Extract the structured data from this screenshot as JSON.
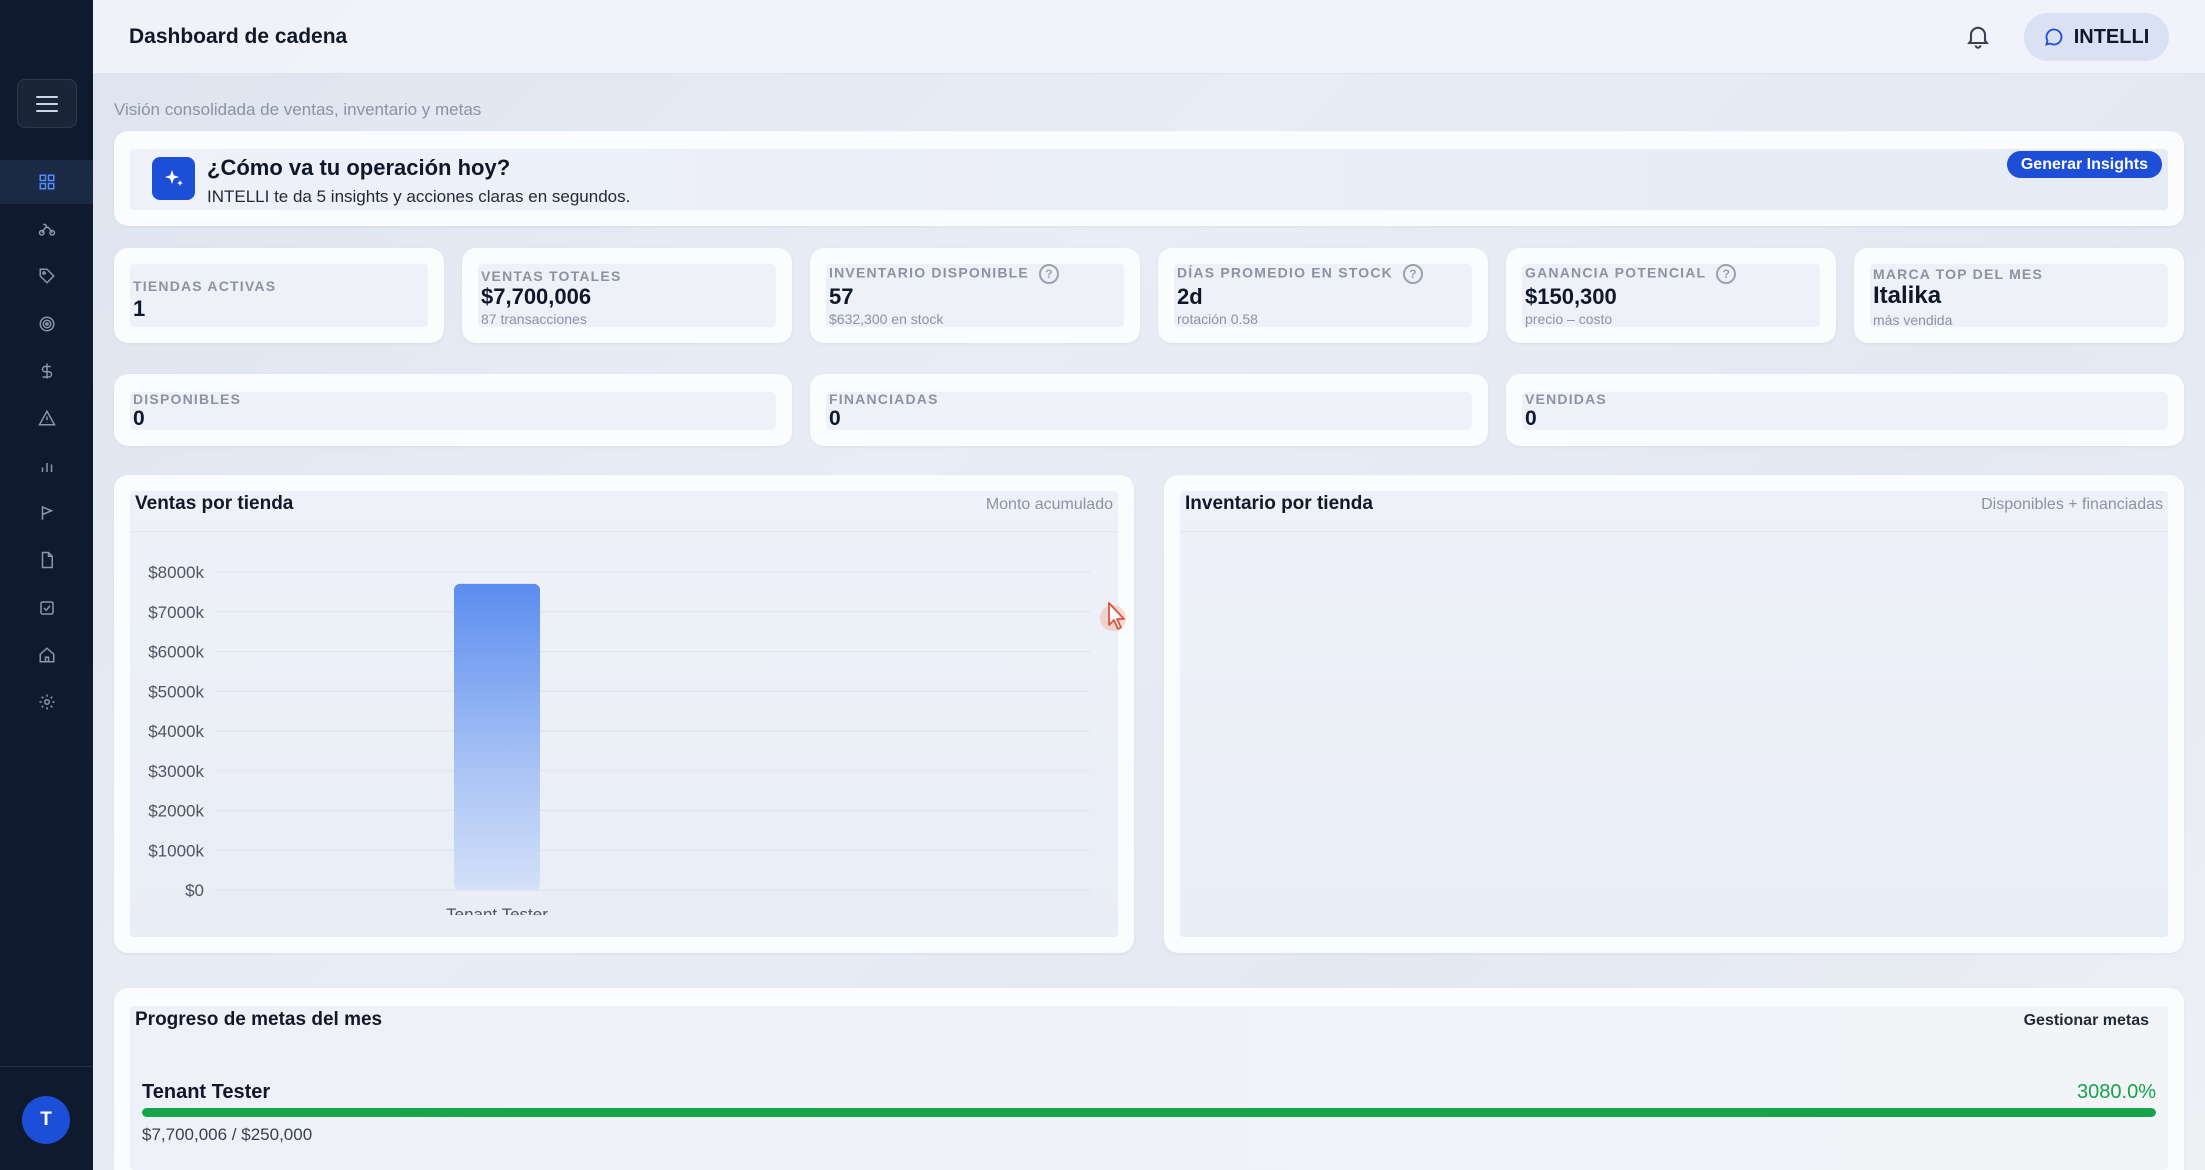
{
  "header": {
    "title": "Dashboard de cadena",
    "assistant_label": "INTELLI"
  },
  "subtitle": "Visión consolidada de ventas, inventario y metas",
  "insight": {
    "title": "¿Cómo va tu operación hoy?",
    "description": "INTELLI te da 5 insights y acciones claras en segundos.",
    "button_label": "Generar Insights"
  },
  "kpis": [
    {
      "label": "TIENDAS ACTIVAS",
      "value": "1",
      "sub": ""
    },
    {
      "label": "VENTAS TOTALES",
      "value": "$7,700,006",
      "sub": "87 transacciones"
    },
    {
      "label": "INVENTARIO DISPONIBLE",
      "value": "57",
      "sub": "$632,300 en stock",
      "help": "?"
    },
    {
      "label": "DÍAS PROMEDIO EN STOCK",
      "value": "2d",
      "sub": "rotación 0.58",
      "help": "?"
    },
    {
      "label": "GANANCIA POTENCIAL",
      "value": "$150,300",
      "sub": "precio – costo",
      "help": "?"
    },
    {
      "label": "MARCA TOP DEL MES",
      "value": "Italika",
      "sub": "más vendida"
    }
  ],
  "status": [
    {
      "label": "DISPONIBLES",
      "value": "0"
    },
    {
      "label": "FINANCIADAS",
      "value": "0"
    },
    {
      "label": "VENDIDAS",
      "value": "0"
    }
  ],
  "sales_chart": {
    "title": "Ventas por tienda",
    "note": "Monto acumulado"
  },
  "inventory_chart": {
    "title": "Inventario por tienda",
    "note": "Disponibles + financiadas"
  },
  "chart_data": {
    "type": "bar",
    "categories": [
      "Tenant Tester"
    ],
    "values": [
      7700006
    ],
    "ylim": [
      0,
      8000000
    ],
    "yticks": [
      "$0",
      "$1000k",
      "$2000k",
      "$3000k",
      "$4000k",
      "$5000k",
      "$6000k",
      "$7000k",
      "$8000k"
    ],
    "grid": true,
    "bar_color": "#5b8def"
  },
  "goals": {
    "title": "Progreso de metas del mes",
    "manage_label": "Gestionar metas",
    "items": [
      {
        "name": "Tenant Tester",
        "percent": "3080.0%",
        "amount": "$7,700,006 / $250,000",
        "progress": 1.0
      }
    ]
  },
  "user": {
    "initial": "T"
  },
  "colors": {
    "sidebar": "#0f1a2e",
    "accent": "#1d4ed8",
    "success": "#16a34a"
  },
  "nav_icons": [
    "dashboard-icon",
    "motorcycle-icon",
    "tag-icon",
    "target-icon",
    "dollar-icon",
    "alert-icon",
    "bar-chart-icon",
    "flag-icon",
    "document-icon",
    "checklist-icon",
    "home-icon",
    "settings-icon"
  ]
}
